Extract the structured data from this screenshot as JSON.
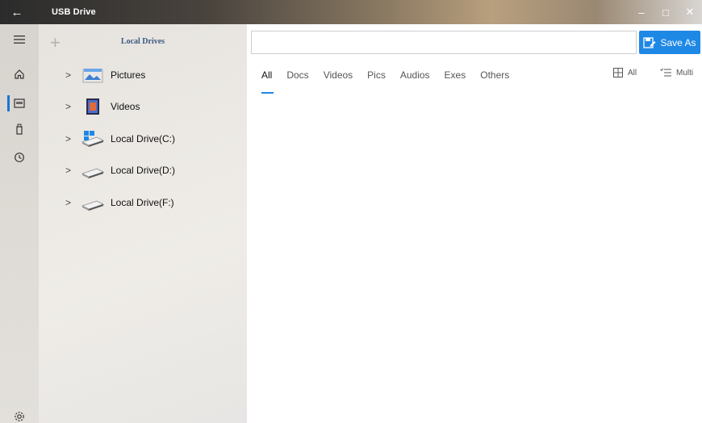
{
  "window": {
    "title": "USB Drive",
    "back_glyph": "←",
    "minimize_glyph": "–",
    "maximize_glyph": "□",
    "close_glyph": "✕"
  },
  "rail": {
    "items": [
      {
        "name": "menu-icon"
      },
      {
        "name": "home-icon"
      },
      {
        "name": "drive-icon",
        "active": true
      },
      {
        "name": "usb-icon"
      },
      {
        "name": "history-icon"
      },
      {
        "name": "settings-icon"
      }
    ]
  },
  "nav": {
    "title": "Local Drives",
    "add_glyph": "+",
    "items": [
      {
        "label": "Pictures",
        "icon": "pictures-folder-icon"
      },
      {
        "label": "Videos",
        "icon": "videos-folder-icon"
      },
      {
        "label": "Local Drive(C:)",
        "icon": "windows-drive-icon"
      },
      {
        "label": "Local Drive(D:)",
        "icon": "drive-icon"
      },
      {
        "label": "Local Drive(F:)",
        "icon": "drive-icon"
      }
    ],
    "chevron_glyph": ">"
  },
  "toolbar": {
    "path_value": "",
    "path_placeholder": "",
    "save_as_label": "Save As"
  },
  "filter_tabs": [
    "All",
    "Docs",
    "Videos",
    "Pics",
    "Audios",
    "Exes",
    "Others"
  ],
  "view": {
    "all_label": "All",
    "multi_label": "Multi"
  },
  "colors": {
    "accent": "#1e88e5"
  }
}
